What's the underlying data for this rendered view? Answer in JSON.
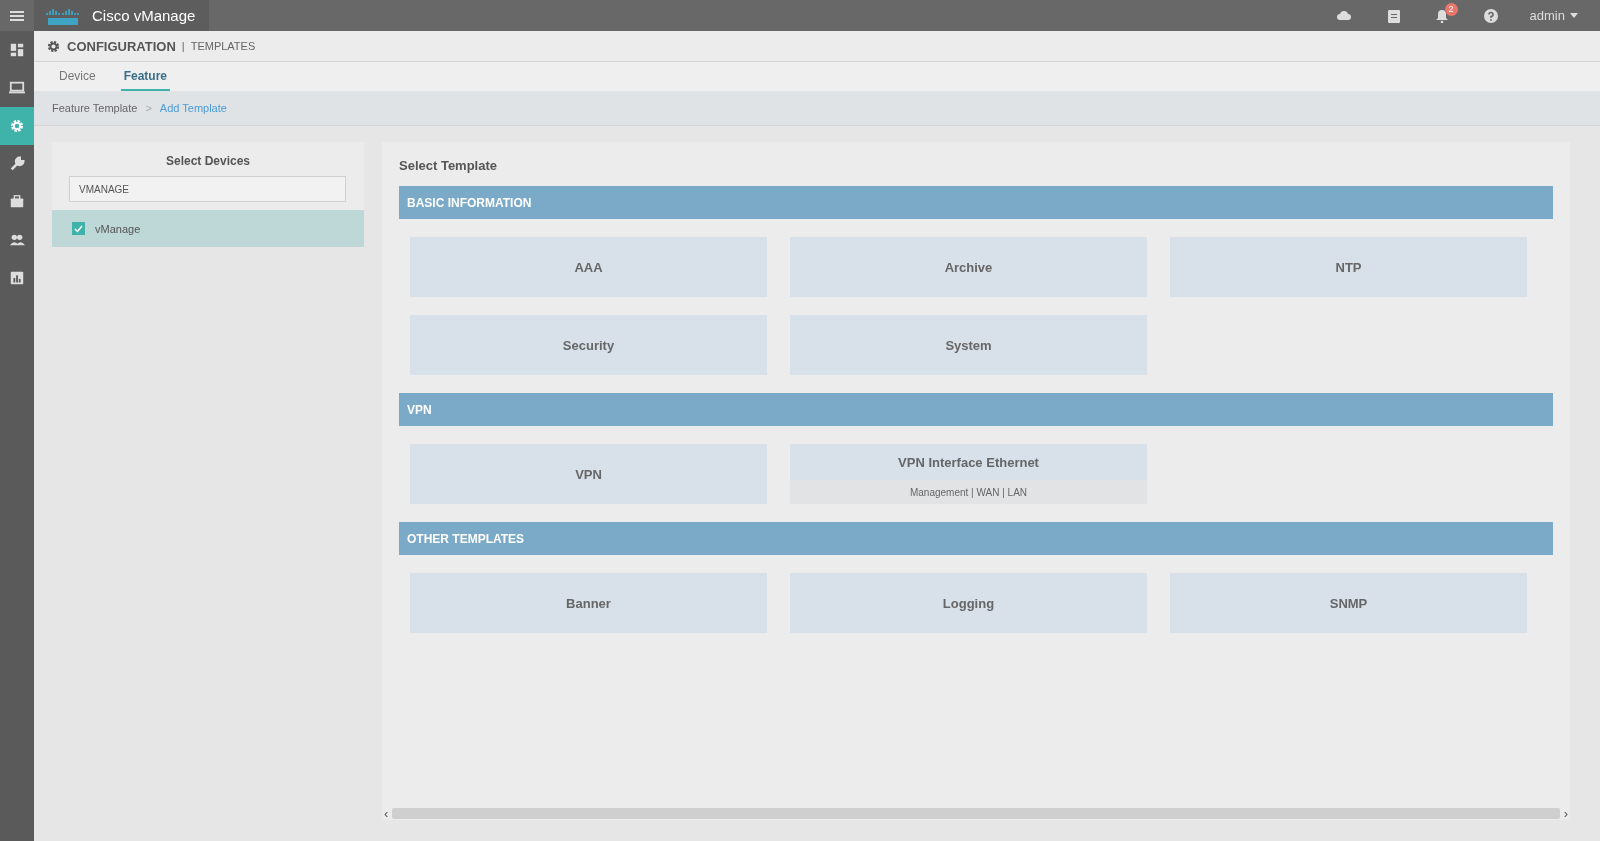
{
  "top_bar": {
    "brand": "Cisco vManage",
    "notification_count": "2",
    "user": "admin"
  },
  "sidebar": {
    "items": [
      {
        "kind": "dashboard",
        "selected": false
      },
      {
        "kind": "monitor",
        "selected": false
      },
      {
        "kind": "gear",
        "selected": true
      },
      {
        "kind": "wrench",
        "selected": false
      },
      {
        "kind": "briefcase",
        "selected": false
      },
      {
        "kind": "people",
        "selected": false
      },
      {
        "kind": "chart",
        "selected": false
      }
    ]
  },
  "header": {
    "title": "CONFIGURATION",
    "separator": "|",
    "subtitle": "TEMPLATES"
  },
  "tabs": [
    {
      "label": "Device",
      "selected": false
    },
    {
      "label": "Feature",
      "selected": true
    }
  ],
  "breadcrumb": {
    "parent": "Feature Template",
    "separator": ">",
    "current": "Add Template"
  },
  "devices_panel": {
    "title": "Select Devices",
    "search": {
      "value": "VMANAGE"
    },
    "devices": [
      {
        "label": "vManage",
        "checked": true
      }
    ]
  },
  "templates_panel": {
    "title": "Select Template",
    "sections": [
      {
        "title": "BASIC INFORMATION",
        "tiles": [
          {
            "label": "AAA"
          },
          {
            "label": "Archive"
          },
          {
            "label": "NTP"
          },
          {
            "label": "Security"
          },
          {
            "label": "System"
          }
        ]
      },
      {
        "title": "VPN",
        "tiles": [
          {
            "label": "VPN"
          },
          {
            "label": "VPN Interface Ethernet",
            "subtitle": "Management | WAN | LAN"
          }
        ]
      },
      {
        "title": "OTHER TEMPLATES",
        "tiles": [
          {
            "label": "Banner"
          },
          {
            "label": "Logging"
          },
          {
            "label": "SNMP"
          }
        ]
      }
    ]
  },
  "scrollbar": {
    "left": "‹",
    "right": "›"
  }
}
